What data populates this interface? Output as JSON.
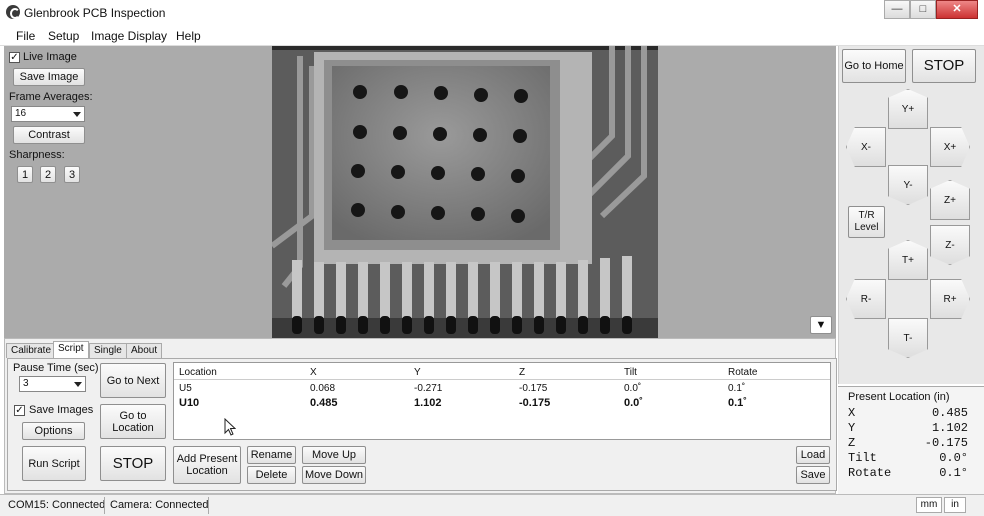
{
  "window": {
    "title": "Glenbrook PCB Inspection",
    "minimize": "—",
    "maximize": "□",
    "close": "✕"
  },
  "menu": [
    "File",
    "Setup",
    "Image Display",
    "Help"
  ],
  "left": {
    "live_image_label": "Live Image",
    "live_image_checked": "✓",
    "save_image": "Save Image",
    "frame_averages_label": "Frame Averages:",
    "frame_averages_value": "16",
    "contrast": "Contrast",
    "sharpness_label": "Sharpness:",
    "sharpness_buttons": [
      "1",
      "2",
      "3"
    ]
  },
  "image": {
    "expand_label": "▼"
  },
  "tabs": [
    "Calibrate",
    "Script",
    "Single",
    "About"
  ],
  "script": {
    "pause_label": "Pause Time (sec)",
    "pause_value": "3",
    "save_images_label": "Save Images",
    "save_images_checked": "✓",
    "options": "Options",
    "run_script": "Run Script",
    "go_next": "Go to Next",
    "go_location": "Go to Location",
    "stop": "STOP",
    "add_present": "Add Present Location",
    "rename": "Rename",
    "delete": "Delete",
    "move_up": "Move Up",
    "move_down": "Move Down",
    "load": "Load",
    "save": "Save"
  },
  "table": {
    "columns": [
      "Location",
      "X",
      "Y",
      "Z",
      "Tilt",
      "Rotate"
    ],
    "rows": [
      [
        "U5",
        "0.068",
        "-0.271",
        "-0.175",
        "0.0˚",
        "0.1˚"
      ],
      [
        "U10",
        "0.485",
        "1.102",
        "-0.175",
        "0.0˚",
        "0.1˚"
      ]
    ]
  },
  "jog": {
    "go_home": "Go to Home",
    "stop": "STOP",
    "y_plus": "Y+",
    "x_minus": "X-",
    "x_plus": "X+",
    "y_minus": "Y-",
    "z_plus": "Z+",
    "tr_level": "T/R Level",
    "z_minus": "Z-",
    "t_plus": "T+",
    "r_minus": "R-",
    "r_plus": "R+",
    "t_minus": "T-"
  },
  "present": {
    "title": "Present Location (in)",
    "labels": [
      "X",
      "Y",
      "Z",
      "Tilt",
      "Rotate"
    ],
    "values": [
      "0.485",
      "1.102",
      "-0.175",
      "0.0°",
      "0.1°"
    ]
  },
  "status": {
    "com": "COM15: Connected",
    "camera": "Camera: Connected",
    "mm": "mm",
    "in": "in"
  }
}
